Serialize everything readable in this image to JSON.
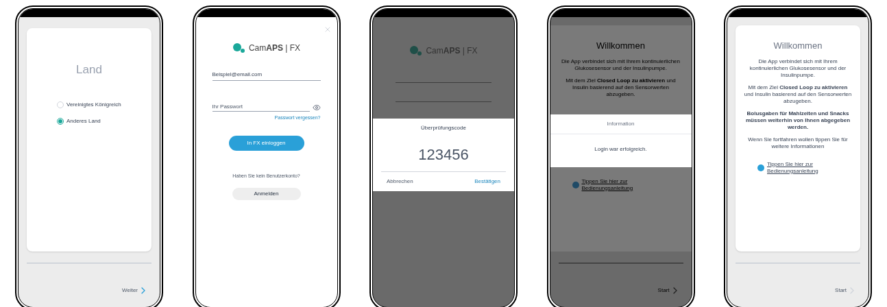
{
  "phones": [
    {
      "kind": "country",
      "dimmed": false,
      "title": "Land",
      "options": [
        {
          "label": "Vereinigtes Königreich",
          "selected": false
        },
        {
          "label": "Anderes Land",
          "selected": true
        }
      ],
      "next": "Weiter"
    },
    {
      "kind": "login",
      "dimmed": false,
      "logo": "Cam**APS** | FX",
      "email": "Beispiel@email.com",
      "password_placeholder": "Ihr Passwort",
      "forgot": "Passwort vergessen?",
      "login_button": "In FX einloggen",
      "no_account": "Haben Sie kein Benutzerkonto?",
      "register_button": "Anmelden"
    },
    {
      "kind": "code",
      "dimmed": true,
      "logo": "Cam**APS** | FX",
      "dialog": {
        "title": "Überprüfungscode",
        "code": "123456",
        "cancel": "Abbrechen",
        "confirm": "Bestätigen"
      }
    },
    {
      "kind": "welcome",
      "dimmed": true,
      "title": "Willkommen",
      "paragraphs": [
        {
          "text": "Die App verbindet sich mit Ihrem kontinuierlichen Glukosesensor und der Insulinpumpe.",
          "bold": false
        },
        {
          "text": "Mit dem Ziel **Closed Loop zu aktivieren** und Insulin basierend auf den Sensorwerten abzugeben.",
          "bold": false
        }
      ],
      "dialog": {
        "title": "Information",
        "message": "Login war erfolgreich."
      },
      "link": "Tippen Sie hier zur Bedienungsanleitung",
      "next": "Start"
    },
    {
      "kind": "welcome",
      "dimmed": false,
      "title": "Willkommen",
      "paragraphs": [
        {
          "text": "Die App verbindet sich mit Ihrem kontinuierlichen Glukosesensor und der Insulinpumpe.",
          "bold": false
        },
        {
          "text": "Mit dem Ziel **Closed Loop zu aktivieren** und Insulin basierend auf den Sensorwerten abzugeben.",
          "bold": false
        },
        {
          "text": "Bolusgaben für Mahlzeiten und Snacks müssen weiterhin von Ihnen abgegeben werden.",
          "bold": true
        },
        {
          "text": "Wenn Sie fortfahren wollen tippen Sie für weitere Informationen",
          "bold": false
        }
      ],
      "link": "Tippen Sie hier zur Bedienungsanleitung",
      "next": "Start"
    }
  ]
}
